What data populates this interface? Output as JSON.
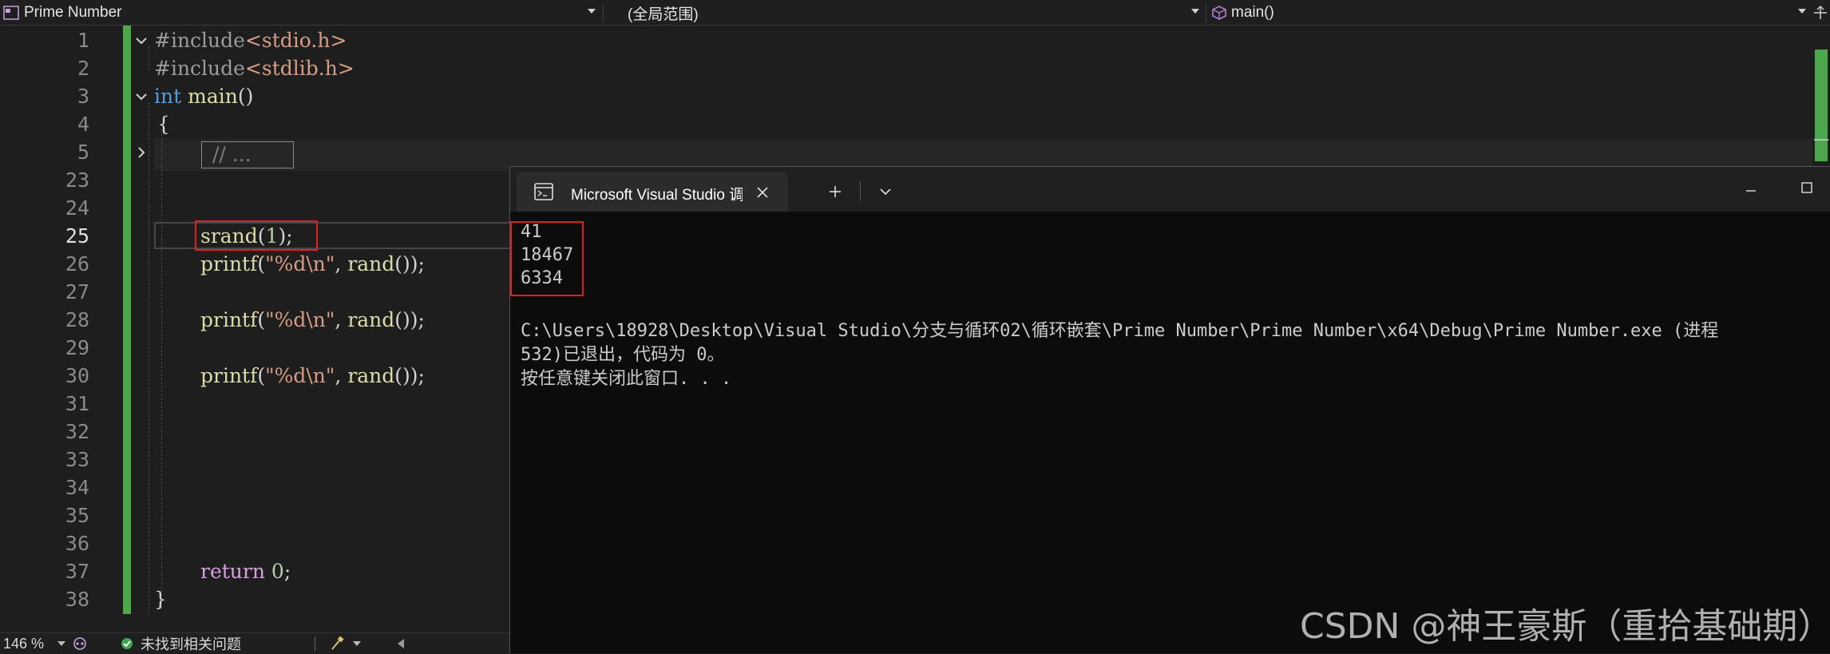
{
  "navbar": {
    "project": "Prime Number",
    "scope": "(全局范围)",
    "function": "main()"
  },
  "editor": {
    "line_numbers": [
      "1",
      "2",
      "3",
      "4",
      "5",
      "23",
      "24",
      "25",
      "26",
      "27",
      "28",
      "29",
      "30",
      "31",
      "32",
      "33",
      "34",
      "35",
      "36",
      "37",
      "38"
    ],
    "current_line": "25",
    "code": {
      "l1_pre": "#include",
      "l1_hdr": "<stdio.h>",
      "l2_pre": "#include",
      "l2_hdr": "<stdlib.h>",
      "l3_type": "int",
      "l3_fn": "main",
      "l3_rest": "()",
      "l4": "{",
      "l5_collapsed": "// ...",
      "l25_fn": "srand",
      "l25_open": "(",
      "l25_num": "1",
      "l25_close": ");",
      "printf_fn": "printf",
      "printf_open": "(",
      "printf_str": "\"%d\\n\"",
      "printf_mid": ", ",
      "rand_fn": "rand",
      "printf_close": "());",
      "l37_kw": "return",
      "l37_num": "0",
      "l37_end": ";",
      "l38": "}"
    }
  },
  "statusbar": {
    "zoom": "146 %",
    "issues": "未找到相关问题"
  },
  "console": {
    "tab_title": "Microsoft Visual Studio 调试控",
    "output": [
      "41",
      "18467",
      "6334"
    ],
    "exit_line1": "C:\\Users\\18928\\Desktop\\Visual Studio\\分支与循环02\\循环嵌套\\Prime Number\\Prime Number\\x64\\Debug\\Prime Number.exe (进程",
    "exit_line2": "532)已退出，代码为 0。",
    "exit_line3": "按任意键关闭此窗口. . ."
  },
  "watermark": "CSDN @神王豪斯（重拾基础期）",
  "colors": {
    "change_bar": "#4ca64c",
    "highlight_box": "#e02020",
    "keyword": "#569cd6",
    "function": "#dcdcaa",
    "string": "#d69d85"
  }
}
